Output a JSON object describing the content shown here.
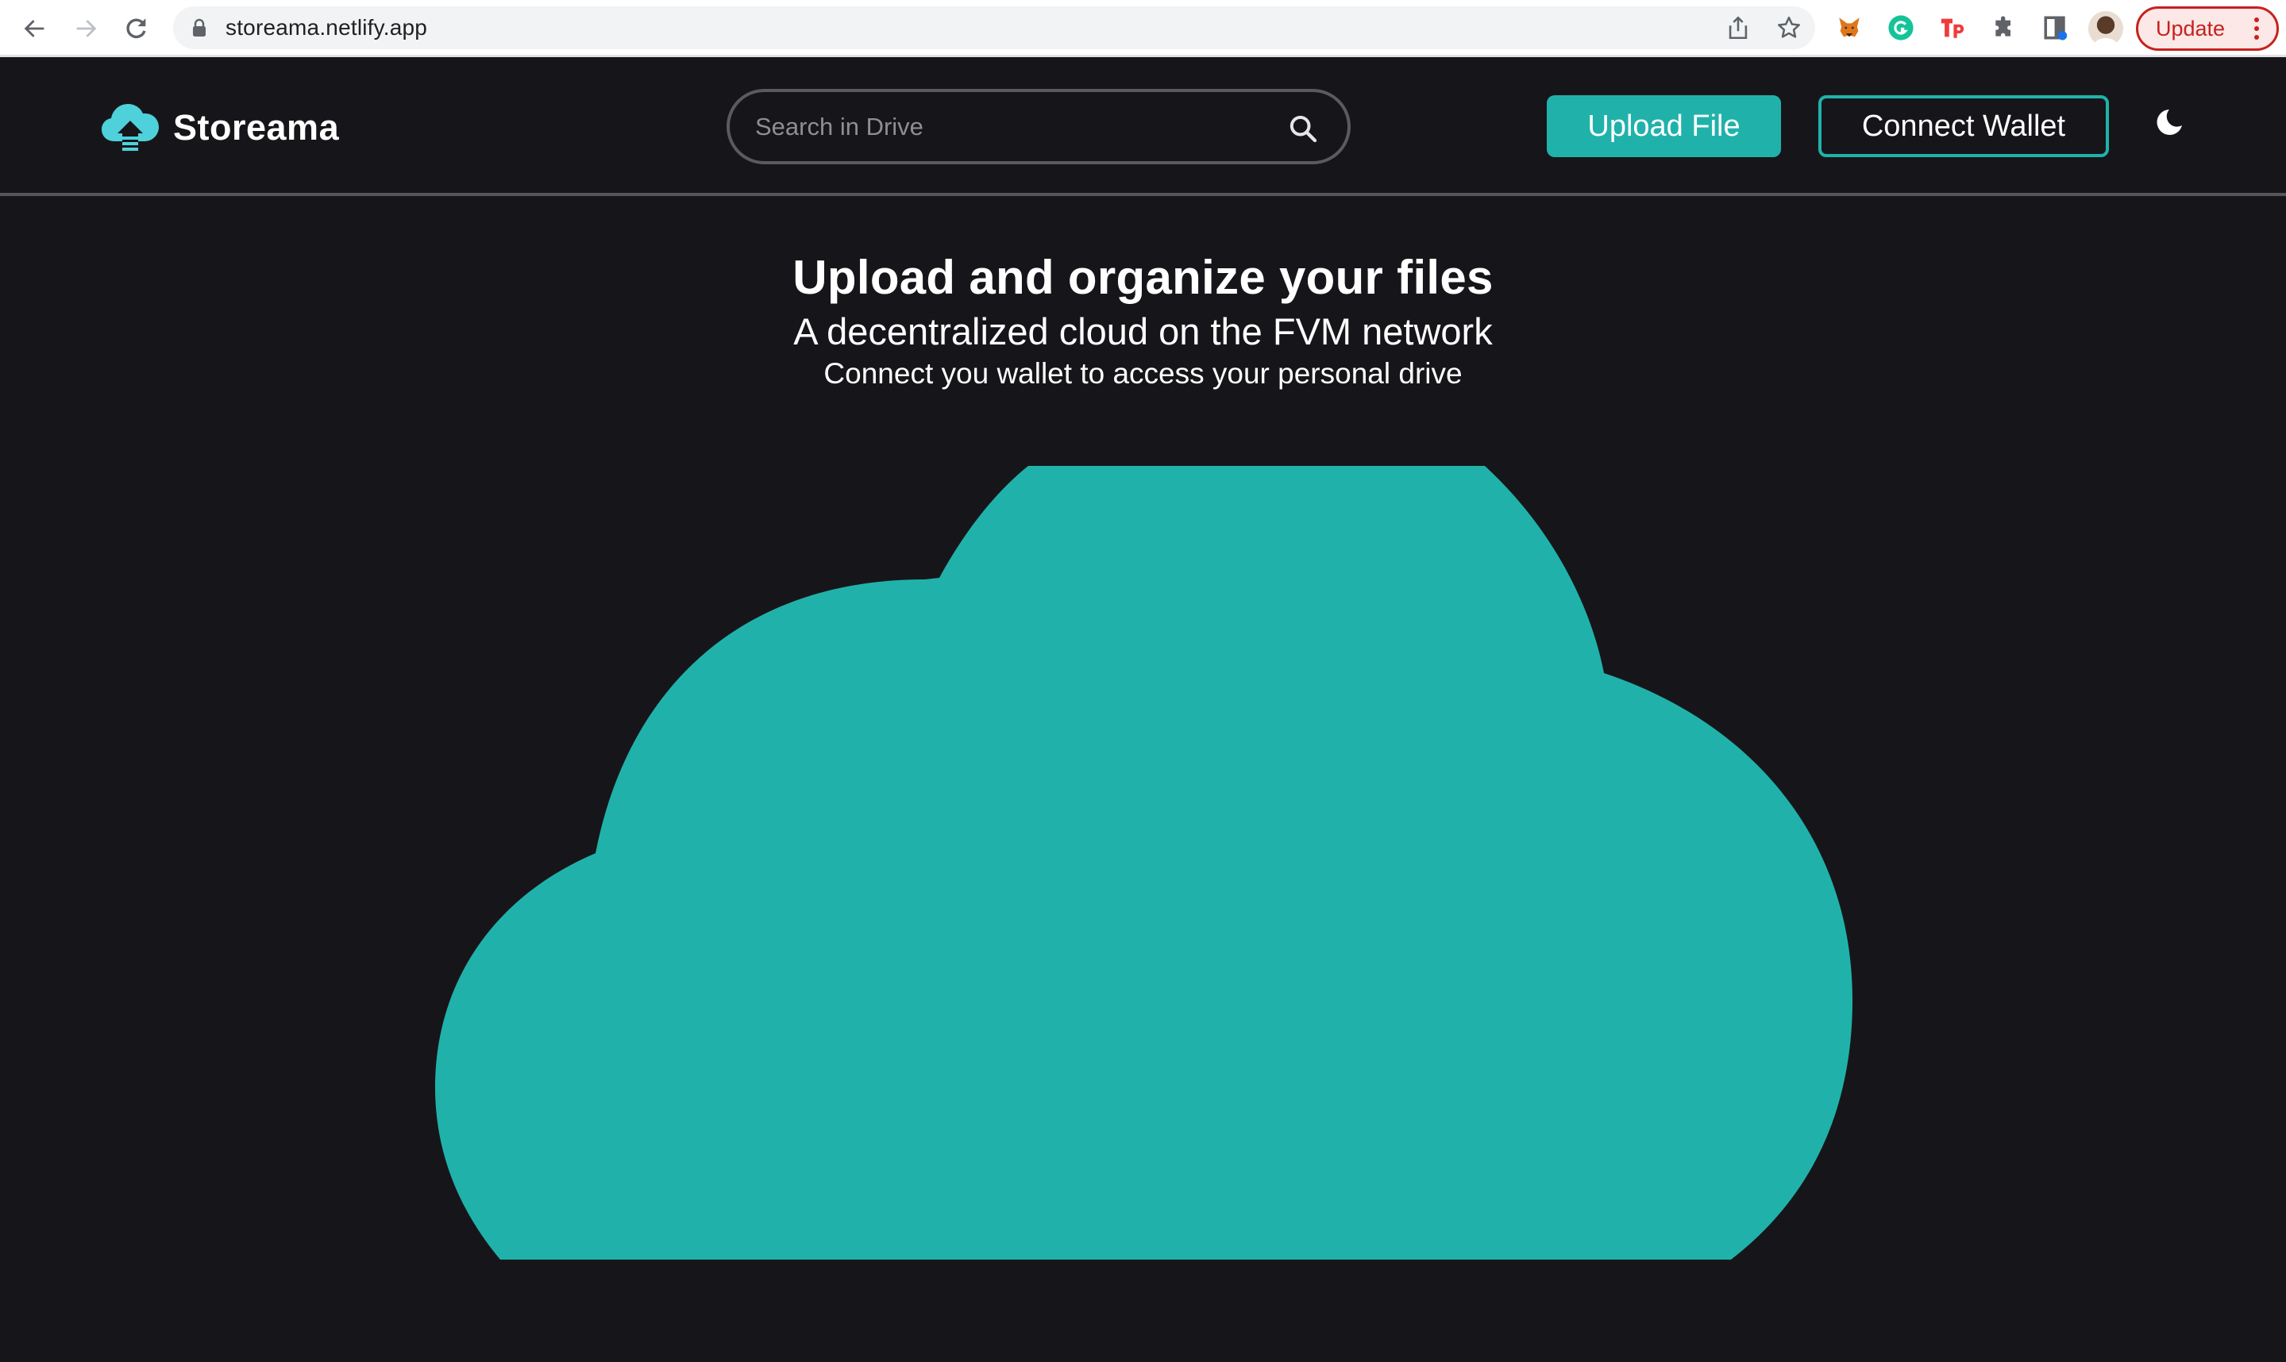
{
  "browser": {
    "url": "storeama.netlify.app",
    "update_label": "Update",
    "icons": {
      "back": "arrow-left-icon",
      "forward": "arrow-right-icon",
      "reload": "reload-icon",
      "lock": "lock-icon",
      "share": "share-icon",
      "bookmark": "star-icon",
      "extensions": [
        "metamask-fox-icon",
        "grammarly-icon",
        "tp-icon",
        "puzzle-extensions-icon",
        "sidepanel-icon"
      ],
      "profile": "profile-avatar",
      "menu": "kebab-menu-icon"
    }
  },
  "header": {
    "brand": "Storeama",
    "logo_icon": "cloud-upload-icon",
    "search": {
      "placeholder": "Search in Drive",
      "value": ""
    },
    "upload_label": "Upload File",
    "connect_label": "Connect Wallet",
    "theme_icon": "moon-icon"
  },
  "hero": {
    "title": "Upload and organize your files",
    "subtitle": "A decentralized cloud on the FVM network",
    "caption": "Connect you wallet to access your personal drive",
    "illustration": "cloud-illustration"
  },
  "colors": {
    "accent": "#20b2aa",
    "background": "#16161a",
    "logo": "#4fd1db",
    "divider": "#55555a",
    "update": "#c5221f"
  }
}
